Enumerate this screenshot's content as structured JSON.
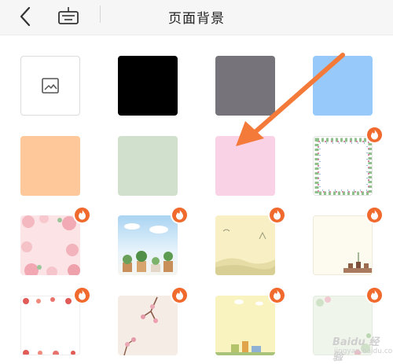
{
  "header": {
    "title": "页面背景",
    "back_icon": "chevron-left-icon",
    "keyboard_icon": "keyboard-icon"
  },
  "backgrounds": [
    {
      "id": "custom-image",
      "kind": "image-picker",
      "icon": "image-icon"
    },
    {
      "id": "black",
      "kind": "solid",
      "color": "#000000"
    },
    {
      "id": "gray",
      "kind": "solid",
      "color": "#76747a"
    },
    {
      "id": "light-blue",
      "kind": "solid",
      "color": "#97c9fb"
    },
    {
      "id": "peach",
      "kind": "solid",
      "color": "#fec89a"
    },
    {
      "id": "sage",
      "kind": "solid",
      "color": "#d0e0cc"
    },
    {
      "id": "pink",
      "kind": "solid",
      "color": "#fad2e6"
    },
    {
      "id": "floral-frame",
      "kind": "pattern",
      "premium": true
    },
    {
      "id": "pink-flowers",
      "kind": "pattern",
      "premium": true
    },
    {
      "id": "sky-succulents",
      "kind": "pattern",
      "premium": true
    },
    {
      "id": "landscape-yellow",
      "kind": "pattern",
      "premium": true
    },
    {
      "id": "cream-pots",
      "kind": "pattern",
      "premium": true
    },
    {
      "id": "red-flowers-border",
      "kind": "pattern",
      "premium": true
    },
    {
      "id": "plum-blossom",
      "kind": "pattern",
      "premium": true
    },
    {
      "id": "yellow-town",
      "kind": "pattern",
      "premium": true
    },
    {
      "id": "green-floral",
      "kind": "pattern",
      "premium": true
    }
  ],
  "premium_badge_icon": "flame-icon",
  "watermark": {
    "text": "Baidu 经验",
    "sub": "jingyan.baidu.com"
  },
  "colors": {
    "accent": "#f06a2e",
    "arrow": "#f47a3a"
  }
}
